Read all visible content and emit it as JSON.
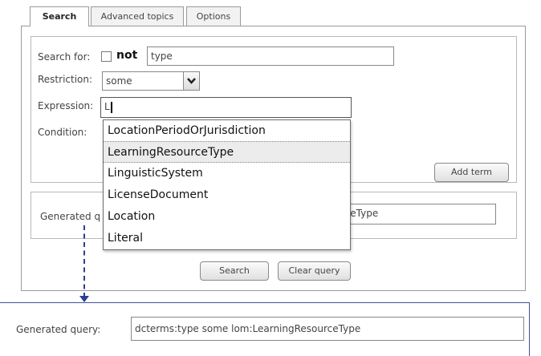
{
  "tabs": [
    {
      "label": "Search",
      "active": true
    },
    {
      "label": "Advanced topics",
      "active": false
    },
    {
      "label": "Options",
      "active": false
    }
  ],
  "form": {
    "search_for_label": "Search for:",
    "not_label": "not",
    "not_checked": false,
    "search_for_value": "type",
    "restriction_label": "Restriction:",
    "restriction_value": "some",
    "expression_label": "Expression:",
    "expression_value": "L",
    "condition_label": "Condition:",
    "add_term_label": "Add term"
  },
  "autocomplete": {
    "options": [
      "LocationPeriodOrJurisdiction",
      "LearningResourceType",
      "LinguisticSystem",
      "LicenseDocument",
      "Location",
      "Literal"
    ],
    "highlighted_index": 1
  },
  "generated": {
    "label_partial": "Generated q",
    "value_partial": "rceType"
  },
  "buttons": {
    "search_label": "Search",
    "clear_label": "Clear query"
  },
  "zoom": {
    "label": "Generated query:",
    "value": "dcterms:type some lom:LearningResourceType"
  },
  "colors": {
    "arrow": "#2b3f8f",
    "highlight": "#ececec"
  },
  "icons": {
    "dropdown_arrow": "chevron-down-icon"
  }
}
